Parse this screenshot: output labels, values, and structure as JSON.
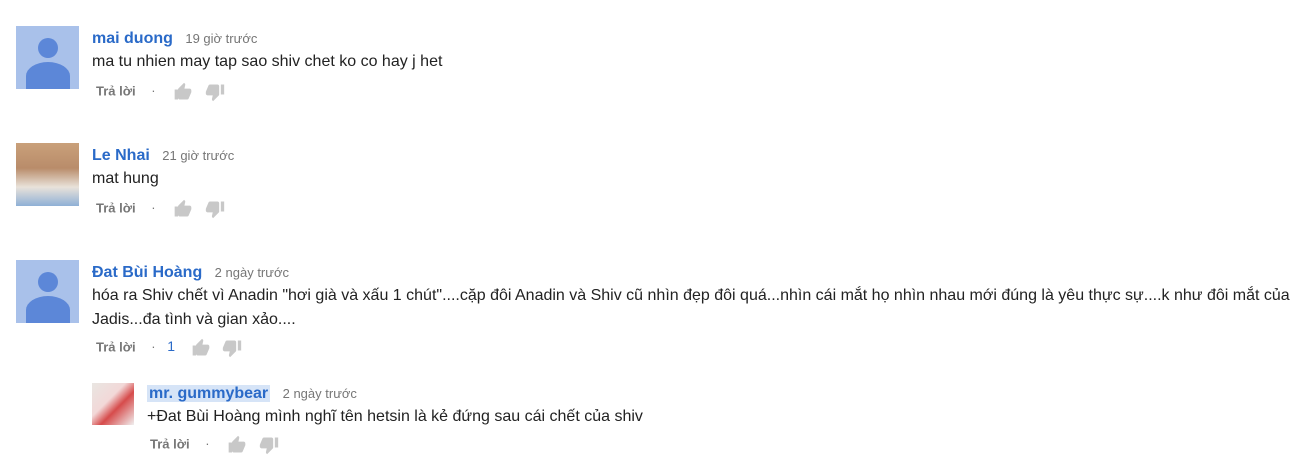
{
  "comments": [
    {
      "author": "mai duong",
      "time": "19 giờ trước",
      "text": "ma tu nhien may tap sao shiv  chet ko co hay j het",
      "reply_label": "Trả lời",
      "likes": "",
      "avatar": "default-avatar"
    },
    {
      "author": "Le Nhai",
      "time": "21 giờ trước",
      "text": "mat hung",
      "reply_label": "Trả lời",
      "likes": "",
      "avatar": "photo-avatar"
    },
    {
      "author": "Đat Bùi Hoàng",
      "time": "2 ngày trước",
      "text": "hóa ra Shiv chết vì Anadin \"hơi già và xấu 1 chút\"....cặp đôi Anadin và Shiv cũ nhìn đẹp đôi quá...nhìn cái mắt họ nhìn nhau mới đúng là yêu thực sự....k như đôi mắt của Jadis...đa tình và gian xảo....",
      "reply_label": "Trả lời",
      "likes": "1",
      "avatar": "default-avatar"
    }
  ],
  "reply": {
    "author": "mr. gummybear",
    "time": "2 ngày trước",
    "text": "+Đat Bùi Hoàng  mình nghĩ  tên hetsin là  kẻ đứng sau cái chết của shiv",
    "reply_label": "Trả lời",
    "likes": "",
    "avatar": "photo-avatar"
  },
  "separator": "·",
  "colors": {
    "author": "#2a6ac8",
    "meta": "#767676",
    "avatar_bg": "#a9c1ea",
    "avatar_fg": "#5c87d8"
  }
}
